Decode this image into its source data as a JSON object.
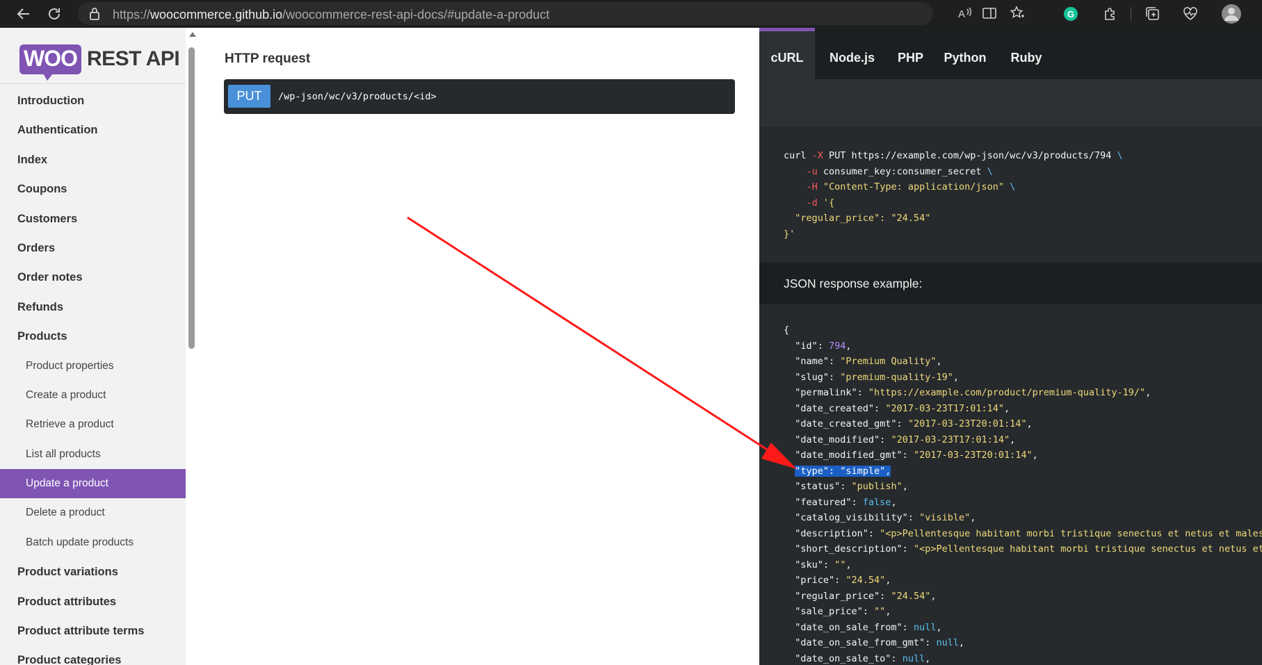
{
  "browser": {
    "url_prefix": "https://",
    "url_host": "woocommerce.github.io",
    "url_path": "/woocommerce-rest-api-docs/#update-a-product"
  },
  "sidebar": {
    "logo_woo": "WOO",
    "logo_text": "REST API",
    "items": [
      {
        "label": "Introduction",
        "type": "section"
      },
      {
        "label": "Authentication",
        "type": "section"
      },
      {
        "label": "Index",
        "type": "section"
      },
      {
        "label": "Coupons",
        "type": "section"
      },
      {
        "label": "Customers",
        "type": "section"
      },
      {
        "label": "Orders",
        "type": "section"
      },
      {
        "label": "Order notes",
        "type": "section"
      },
      {
        "label": "Refunds",
        "type": "section"
      },
      {
        "label": "Products",
        "type": "section"
      },
      {
        "label": "Product properties",
        "type": "sub"
      },
      {
        "label": "Create a product",
        "type": "sub"
      },
      {
        "label": "Retrieve a product",
        "type": "sub"
      },
      {
        "label": "List all products",
        "type": "sub"
      },
      {
        "label": "Update a product",
        "type": "sub",
        "active": true
      },
      {
        "label": "Delete a product",
        "type": "sub"
      },
      {
        "label": "Batch update products",
        "type": "sub"
      },
      {
        "label": "Product variations",
        "type": "section"
      },
      {
        "label": "Product attributes",
        "type": "section"
      },
      {
        "label": "Product attribute terms",
        "type": "section"
      },
      {
        "label": "Product categories",
        "type": "section"
      }
    ]
  },
  "main": {
    "http_title": "HTTP request",
    "method": "PUT",
    "endpoint": "/wp-json/wc/v3/products/<id>"
  },
  "code_panel": {
    "tabs": [
      "cURL",
      "Node.js",
      "PHP",
      "Python",
      "Ruby"
    ],
    "active_tab": "cURL",
    "response_title": "JSON response example:",
    "curl_lines": [
      [
        [
          "k",
          "curl "
        ],
        [
          "o",
          "-X"
        ],
        [
          "k",
          " PUT https://example.com/wp-json/wc/v3/products/794 "
        ],
        [
          "b",
          "\\"
        ]
      ],
      [
        [
          "k",
          "    "
        ],
        [
          "o",
          "-u"
        ],
        [
          "k",
          " consumer_key:consumer_secret "
        ],
        [
          "b",
          "\\"
        ]
      ],
      [
        [
          "k",
          "    "
        ],
        [
          "o",
          "-H"
        ],
        [
          "k",
          " "
        ],
        [
          "s",
          "\"Content-Type: application/json\""
        ],
        [
          "k",
          " "
        ],
        [
          "b",
          "\\"
        ]
      ],
      [
        [
          "k",
          "    "
        ],
        [
          "o",
          "-d"
        ],
        [
          "k",
          " "
        ],
        [
          "s",
          "'{"
        ]
      ],
      [
        [
          "s",
          "  \"regular_price\": \"24.54\""
        ]
      ],
      [
        [
          "s",
          "}'"
        ]
      ]
    ],
    "json_lines": [
      [
        [
          "k",
          "{"
        ]
      ],
      [
        [
          "k",
          "  \"id\": "
        ],
        [
          "n",
          "794"
        ],
        [
          "k",
          ","
        ]
      ],
      [
        [
          "k",
          "  \"name\": "
        ],
        [
          "s",
          "\"Premium Quality\""
        ],
        [
          "k",
          ","
        ]
      ],
      [
        [
          "k",
          "  \"slug\": "
        ],
        [
          "s",
          "\"premium-quality-19\""
        ],
        [
          "k",
          ","
        ]
      ],
      [
        [
          "k",
          "  \"permalink\": "
        ],
        [
          "s",
          "\"https://example.com/product/premium-quality-19/\""
        ],
        [
          "k",
          ","
        ]
      ],
      [
        [
          "k",
          "  \"date_created\": "
        ],
        [
          "s",
          "\"2017-03-23T17:01:14\""
        ],
        [
          "k",
          ","
        ]
      ],
      [
        [
          "k",
          "  \"date_created_gmt\": "
        ],
        [
          "s",
          "\"2017-03-23T20:01:14\""
        ],
        [
          "k",
          ","
        ]
      ],
      [
        [
          "k",
          "  \"date_modified\": "
        ],
        [
          "s",
          "\"2017-03-23T17:01:14\""
        ],
        [
          "k",
          ","
        ]
      ],
      [
        [
          "k",
          "  \"date_modified_gmt\": "
        ],
        [
          "s",
          "\"2017-03-23T20:01:14\""
        ],
        [
          "k",
          ","
        ]
      ],
      [
        [
          "k",
          "  "
        ],
        [
          "hl",
          "\"type\": \"simple\","
        ]
      ],
      [
        [
          "k",
          "  \"status\": "
        ],
        [
          "s",
          "\"publish\""
        ],
        [
          "k",
          ","
        ]
      ],
      [
        [
          "k",
          "  \"featured\": "
        ],
        [
          "b",
          "false"
        ],
        [
          "k",
          ","
        ]
      ],
      [
        [
          "k",
          "  \"catalog_visibility\": "
        ],
        [
          "s",
          "\"visible\""
        ],
        [
          "k",
          ","
        ]
      ],
      [
        [
          "k",
          "  \"description\": "
        ],
        [
          "s",
          "\"<p>Pellentesque habitant morbi tristique senectus et netus et malesuada fames ac turpis egestas.</p>\""
        ]
      ],
      [
        [
          "k",
          "  \"short_description\": "
        ],
        [
          "s",
          "\"<p>Pellentesque habitant morbi tristique senectus et netus et malesuada fames.</p>\""
        ]
      ],
      [
        [
          "k",
          "  \"sku\": "
        ],
        [
          "s",
          "\"\""
        ],
        [
          "k",
          ","
        ]
      ],
      [
        [
          "k",
          "  \"price\": "
        ],
        [
          "s",
          "\"24.54\""
        ],
        [
          "k",
          ","
        ]
      ],
      [
        [
          "k",
          "  \"regular_price\": "
        ],
        [
          "s",
          "\"24.54\""
        ],
        [
          "k",
          ","
        ]
      ],
      [
        [
          "k",
          "  \"sale_price\": "
        ],
        [
          "s",
          "\"\""
        ],
        [
          "k",
          ","
        ]
      ],
      [
        [
          "k",
          "  \"date_on_sale_from\": "
        ],
        [
          "b",
          "null"
        ],
        [
          "k",
          ","
        ]
      ],
      [
        [
          "k",
          "  \"date_on_sale_from_gmt\": "
        ],
        [
          "b",
          "null"
        ],
        [
          "k",
          ","
        ]
      ],
      [
        [
          "k",
          "  \"date_on_sale_to\": "
        ],
        [
          "b",
          "null"
        ],
        [
          "k",
          ","
        ]
      ]
    ]
  },
  "annotation": {
    "arrow_color": "#ff1a1a"
  }
}
